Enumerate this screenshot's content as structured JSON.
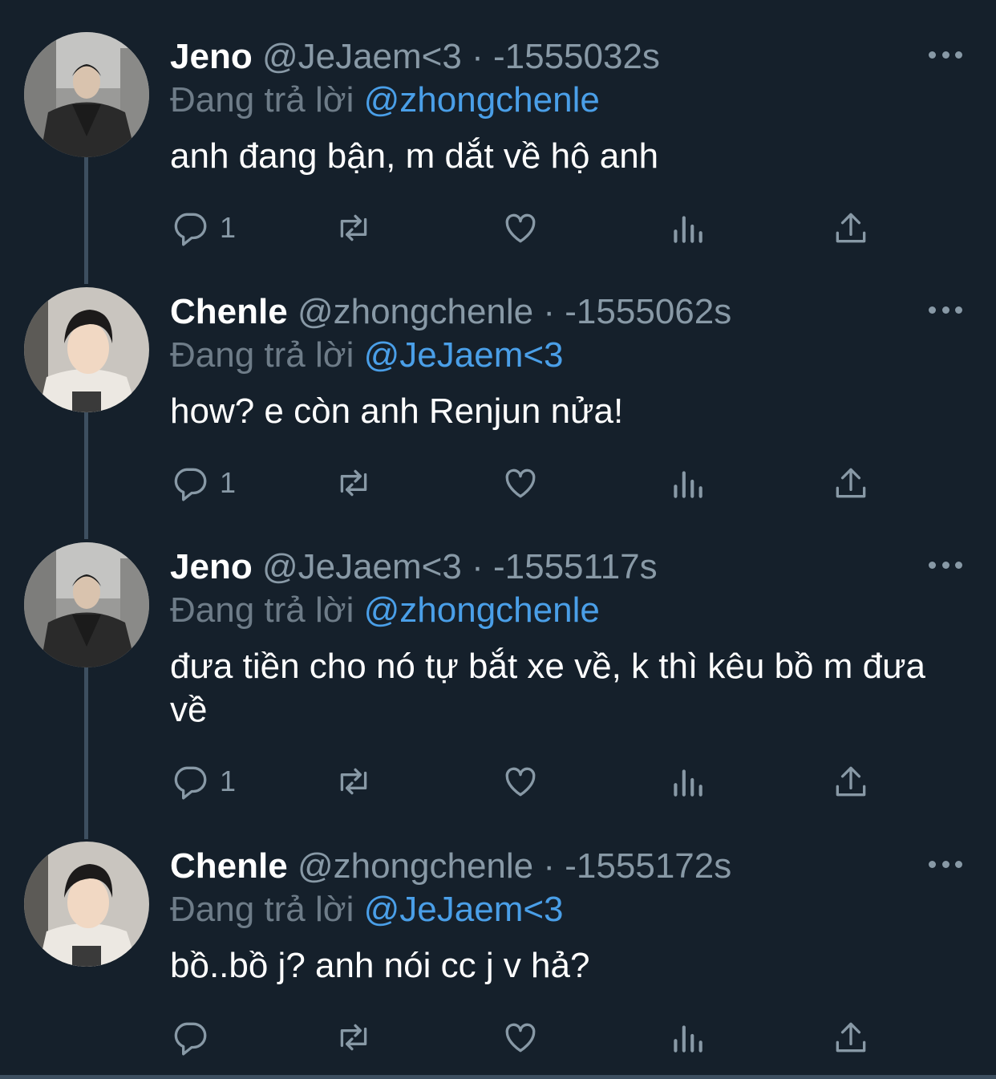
{
  "tweets": [
    {
      "name": "Jeno",
      "handle": "@JeJaem<3",
      "dot": "·",
      "time": "-1555032s",
      "reply_label": "Đang trả lời",
      "reply_handle": "@zhongchenle",
      "text": "anh đang bận, m dắt về hộ anh",
      "reply_count": "1"
    },
    {
      "name": "Chenle",
      "handle": "@zhongchenle",
      "dot": "·",
      "time": "-1555062s",
      "reply_label": "Đang trả lời",
      "reply_handle": "@JeJaem<3",
      "text": "how? e còn anh Renjun nửa!",
      "reply_count": "1"
    },
    {
      "name": "Jeno",
      "handle": "@JeJaem<3",
      "dot": "·",
      "time": "-1555117s",
      "reply_label": "Đang trả lời",
      "reply_handle": "@zhongchenle",
      "text": "đưa tiền cho nó tự bắt xe về, k thì kêu bồ m đưa về",
      "reply_count": "1"
    },
    {
      "name": "Chenle",
      "handle": "@zhongchenle",
      "dot": "·",
      "time": "-1555172s",
      "reply_label": "Đang trả lời",
      "reply_handle": "@JeJaem<3",
      "text": "bồ..bồ j? anh nói cc j v hả?",
      "reply_count": ""
    }
  ],
  "icons": {
    "reply": "reply-icon",
    "retweet": "retweet-icon",
    "like": "heart-icon",
    "analytics": "analytics-icon",
    "share": "share-icon",
    "more": "more-icon"
  },
  "colors": {
    "background": "#15202b",
    "secondary_text": "#8899a6",
    "link": "#4a9fe8",
    "thread_line": "#3d4f60"
  }
}
